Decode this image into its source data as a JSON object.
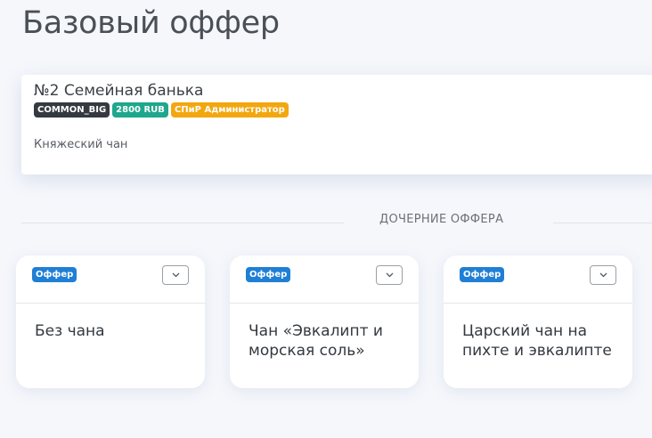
{
  "page": {
    "title": "Базовый оффер"
  },
  "base_offer": {
    "title": "№2 Семейная банька",
    "badges": [
      {
        "label": "COMMON_BIG",
        "color": "#343a40"
      },
      {
        "label": "2800 RUB",
        "color": "#1fa78c"
      },
      {
        "label": "СПиР Администратор",
        "color": "#f3a70f"
      }
    ],
    "description": "Княжеский чан"
  },
  "child_offers": {
    "section_label": "ДОЧЕРНИЕ ОФФЕРА",
    "items": [
      {
        "badge": "Оффер",
        "title": "Без чана",
        "dropdown_icon": "chevron-down-icon"
      },
      {
        "badge": "Оффер",
        "title": "Чан «Эвкалипт и морская соль»",
        "dropdown_icon": "chevron-down-icon"
      },
      {
        "badge": "Оффер",
        "title": "Царский чан на пихте и эвкалипте",
        "dropdown_icon": "chevron-down-icon"
      }
    ]
  },
  "colors": {
    "offer_badge": "#1f7fd6",
    "background": "#f5f7fb"
  }
}
